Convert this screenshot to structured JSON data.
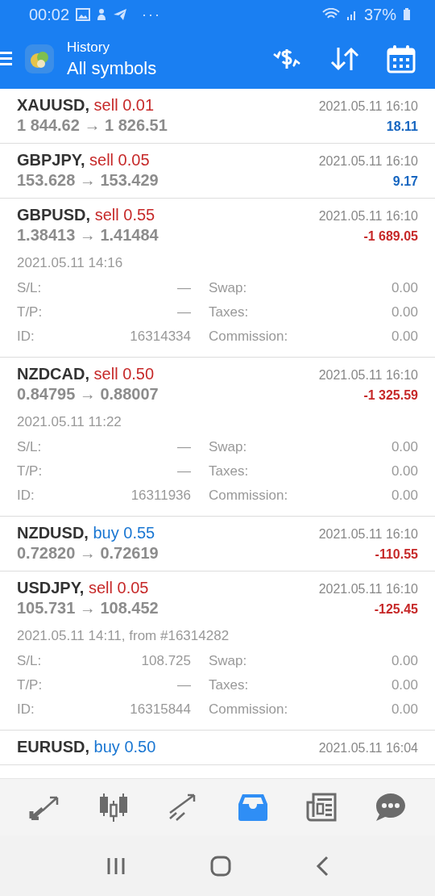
{
  "status_bar": {
    "time": "00:02",
    "more": "···",
    "battery": "37%"
  },
  "app_bar": {
    "title": "History",
    "subtitle": "All symbols"
  },
  "deals": [
    {
      "symbol": "XAUUSD,",
      "side": "sell",
      "volume": "0.01",
      "prices": "1 844.62 → 1 826.51",
      "time": "2021.05.11 16:10",
      "profit": "18.11",
      "loss": false,
      "expanded": false
    },
    {
      "symbol": "GBPJPY,",
      "side": "sell",
      "volume": "0.05",
      "prices": "153.628 → 153.429",
      "time": "2021.05.11 16:10",
      "profit": "9.17",
      "loss": false,
      "expanded": false
    },
    {
      "symbol": "GBPUSD,",
      "side": "sell",
      "volume": "0.55",
      "prices": "1.38413 → 1.41484",
      "time": "2021.05.11 16:10",
      "profit": "-1 689.05",
      "loss": true,
      "expanded": true,
      "open_time": "2021.05.11 14:16",
      "details": [
        {
          "label": "S/L:",
          "value": "—",
          "label2": "Swap:",
          "value2": "0.00"
        },
        {
          "label": "T/P:",
          "value": "—",
          "label2": "Taxes:",
          "value2": "0.00"
        },
        {
          "label": "ID:",
          "value": "16314334",
          "label2": "Commission:",
          "value2": "0.00"
        }
      ]
    },
    {
      "symbol": "NZDCAD,",
      "side": "sell",
      "volume": "0.50",
      "prices": "0.84795 → 0.88007",
      "time": "2021.05.11 16:10",
      "profit": "-1 325.59",
      "loss": true,
      "expanded": true,
      "open_time": "2021.05.11 11:22",
      "details": [
        {
          "label": "S/L:",
          "value": "—",
          "label2": "Swap:",
          "value2": "0.00"
        },
        {
          "label": "T/P:",
          "value": "—",
          "label2": "Taxes:",
          "value2": "0.00"
        },
        {
          "label": "ID:",
          "value": "16311936",
          "label2": "Commission:",
          "value2": "0.00"
        }
      ]
    },
    {
      "symbol": "NZDUSD,",
      "side": "buy",
      "volume": "0.55",
      "prices": "0.72820 → 0.72619",
      "time": "2021.05.11 16:10",
      "profit": "-110.55",
      "loss": true,
      "expanded": false
    },
    {
      "symbol": "USDJPY,",
      "side": "sell",
      "volume": "0.05",
      "prices": "105.731 → 108.452",
      "time": "2021.05.11 16:10",
      "profit": "-125.45",
      "loss": true,
      "expanded": true,
      "open_time": "2021.05.11 14:11, from #16314282",
      "details": [
        {
          "label": "S/L:",
          "value": "108.725",
          "label2": "Swap:",
          "value2": "0.00"
        },
        {
          "label": "T/P:",
          "value": "—",
          "label2": "Taxes:",
          "value2": "0.00"
        },
        {
          "label": "ID:",
          "value": "16315844",
          "label2": "Commission:",
          "value2": "0.00"
        }
      ]
    },
    {
      "symbol": "EURUSD,",
      "side": "buy",
      "volume": "0.50",
      "time": "2021.05.11 16:04",
      "expanded": false
    }
  ],
  "bottom_nav": [
    {
      "kind": "trade",
      "selected": false
    },
    {
      "kind": "chart",
      "selected": false
    },
    {
      "kind": "trend",
      "selected": false
    },
    {
      "kind": "history",
      "selected": true
    },
    {
      "kind": "news",
      "selected": false
    },
    {
      "kind": "chat",
      "selected": false
    }
  ]
}
